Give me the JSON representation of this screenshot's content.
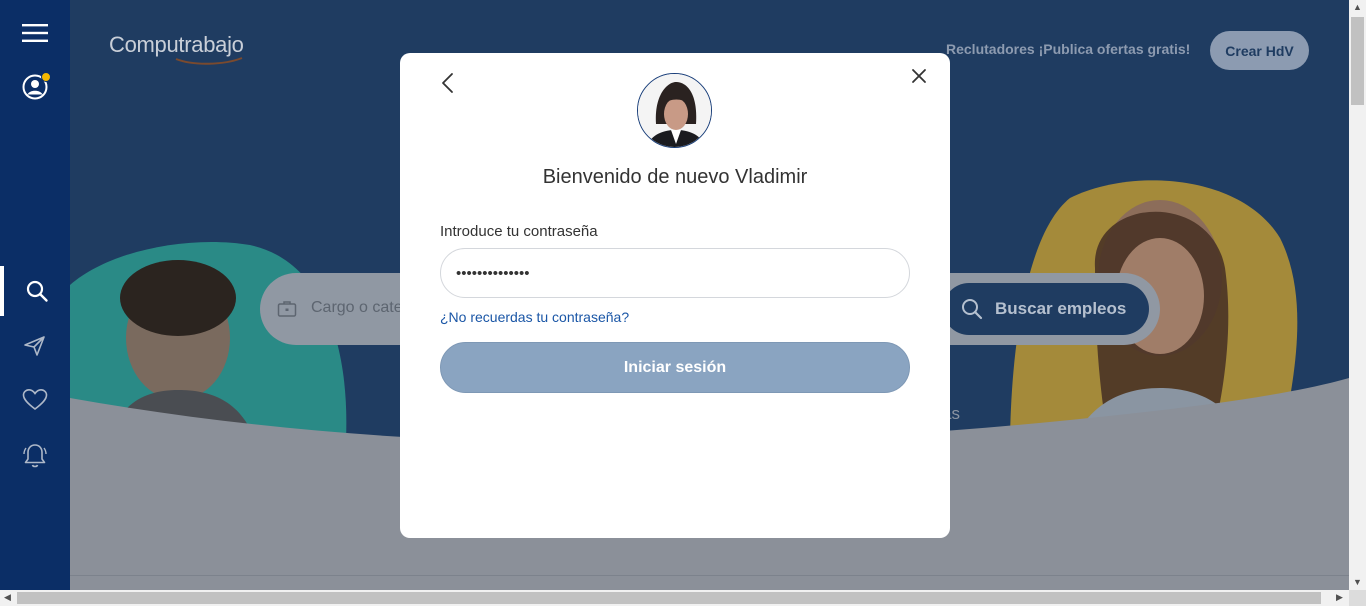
{
  "brand": {
    "logo_text": "Computrabajo"
  },
  "header": {
    "recruiters_link": "Reclutadores ¡Publica ofertas gratis!",
    "create_cv_button": "Crear HdV"
  },
  "sidebar": {
    "items": [
      {
        "icon": "menu-icon"
      },
      {
        "icon": "user-icon",
        "has_notification": true
      },
      {
        "icon": "search-icon",
        "active": true
      },
      {
        "icon": "send-icon"
      },
      {
        "icon": "heart-icon"
      },
      {
        "icon": "bell-icon"
      }
    ]
  },
  "hero": {
    "search_placeholder": "Cargo o cate",
    "search_button": "Buscar empleos",
    "partial_text": "as"
  },
  "modal": {
    "welcome": "Bienvenido de nuevo Vladimir",
    "password_label": "Introduce tu contraseña",
    "password_value": "••••••••••••••",
    "forgot_link": "¿No recuerdas tu contraseña?",
    "login_button": "Iniciar sesión"
  },
  "colors": {
    "sidebar": "#0b2e66",
    "hero_overlay": "#1f3c61",
    "login_button": "#8aa4c1",
    "link": "#1a56a6",
    "accent_yellow": "#f5b800"
  }
}
